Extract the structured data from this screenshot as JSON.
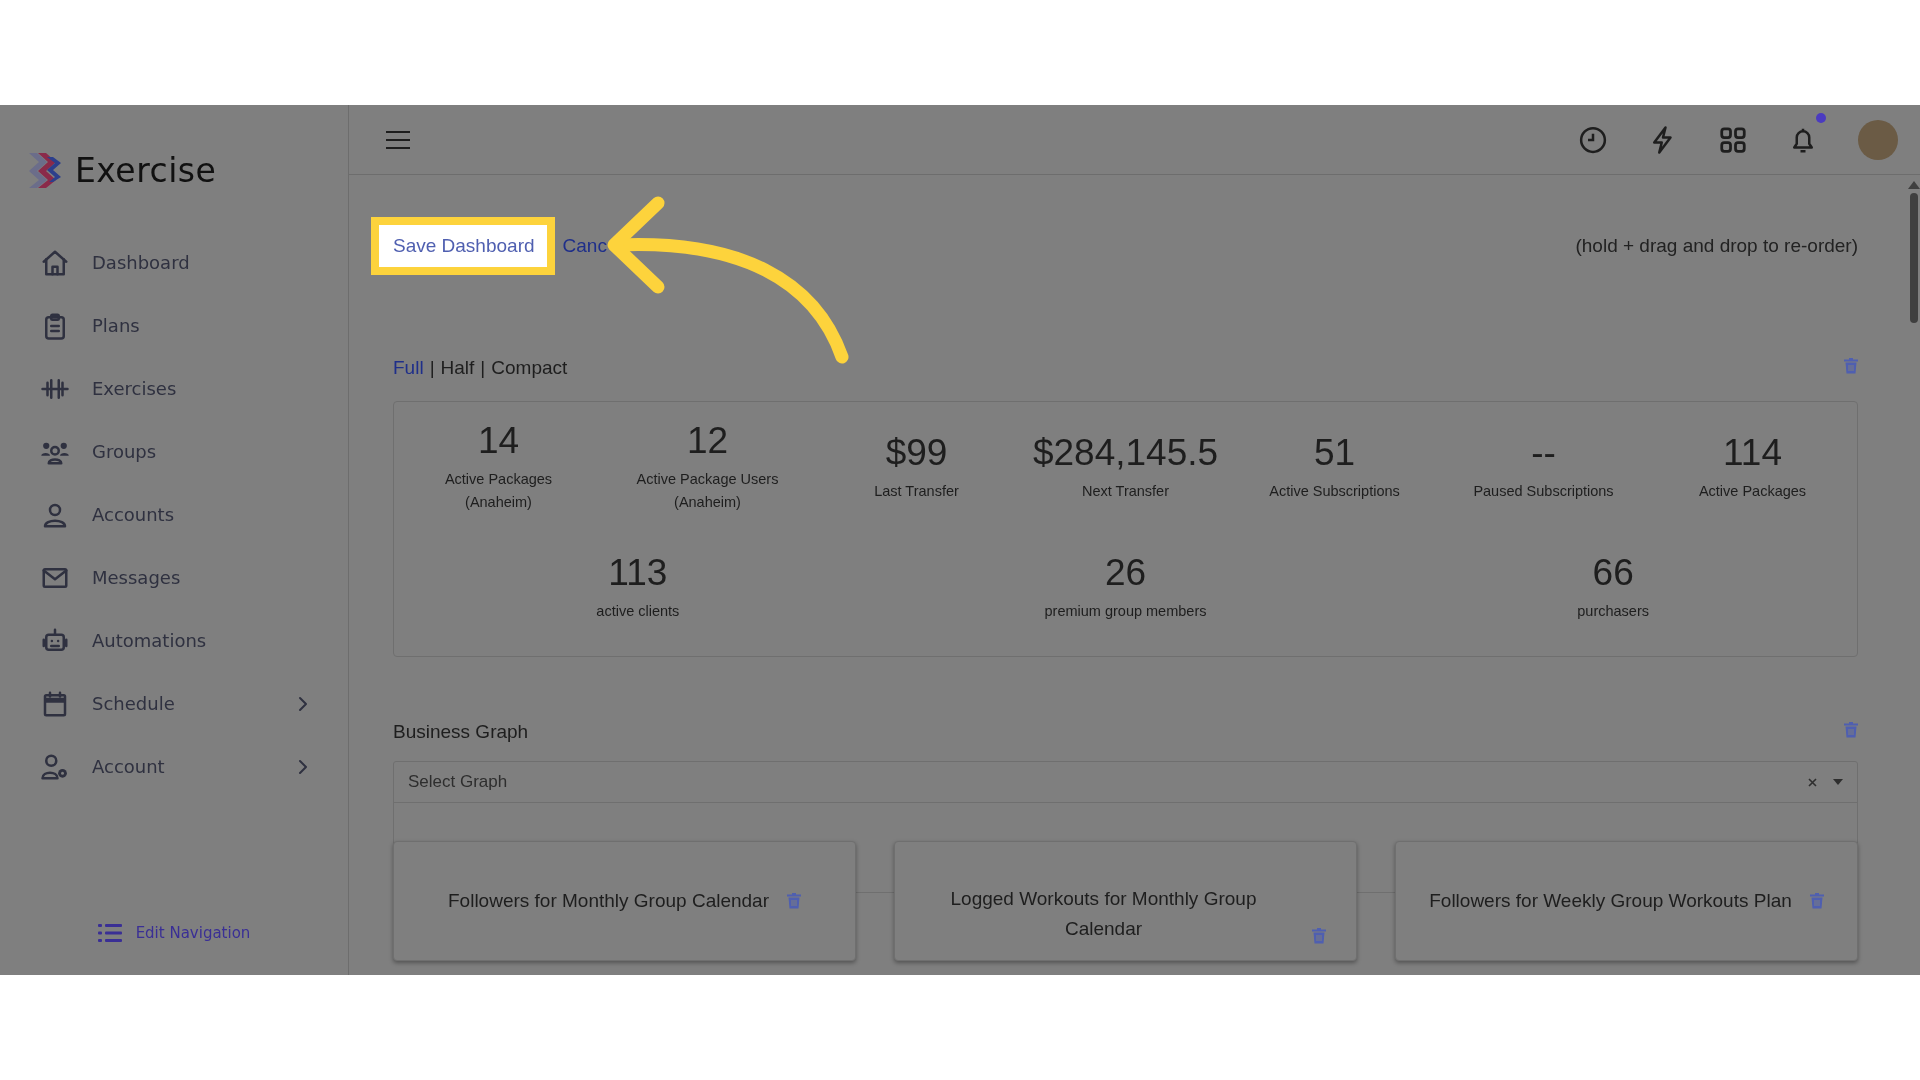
{
  "brand": {
    "name": "Exercise"
  },
  "nav": [
    {
      "label": "Dashboard",
      "expandable": false
    },
    {
      "label": "Plans",
      "expandable": false
    },
    {
      "label": "Exercises",
      "expandable": false
    },
    {
      "label": "Groups",
      "expandable": false
    },
    {
      "label": "Accounts",
      "expandable": false
    },
    {
      "label": "Messages",
      "expandable": false
    },
    {
      "label": "Automations",
      "expandable": false
    },
    {
      "label": "Schedule",
      "expandable": true
    },
    {
      "label": "Account",
      "expandable": true
    }
  ],
  "edit_navigation": "Edit Navigation",
  "header": {
    "notification_unread": true
  },
  "toolbar": {
    "save": "Save Dashboard",
    "cancel": "Canc",
    "hint": "(hold + drag and drop to re-order)"
  },
  "layout_separator": "|",
  "layout_options": [
    {
      "label": "Full",
      "selected": true
    },
    {
      "label": "Half",
      "selected": false
    },
    {
      "label": "Compact",
      "selected": false
    }
  ],
  "stats": {
    "top": [
      {
        "value": "14",
        "label": "Active Packages",
        "sublabel": "(Anaheim)"
      },
      {
        "value": "12",
        "label": "Active Package Users",
        "sublabel": "(Anaheim)"
      },
      {
        "value": "$99",
        "label": "Last Transfer"
      },
      {
        "value": "$284,145.5",
        "label": "Next Transfer"
      },
      {
        "value": "51",
        "label": "Active Subscriptions"
      },
      {
        "value": "--",
        "label": "Paused Subscriptions"
      },
      {
        "value": "114",
        "label": "Active Packages"
      }
    ],
    "bottom": [
      {
        "value": "113",
        "label": "active clients"
      },
      {
        "value": "26",
        "label": "premium group members"
      },
      {
        "value": "66",
        "label": "purchasers"
      }
    ]
  },
  "business_graph": {
    "title": "Business Graph",
    "select": {
      "placeholder": "Select Graph"
    }
  },
  "graph_cards": [
    {
      "title": "Followers for Monthly Group Calendar"
    },
    {
      "title": "Logged Workouts for Monthly Group Calendar"
    },
    {
      "title": "Followers for Weekly Group Workouts Plan"
    }
  ]
}
